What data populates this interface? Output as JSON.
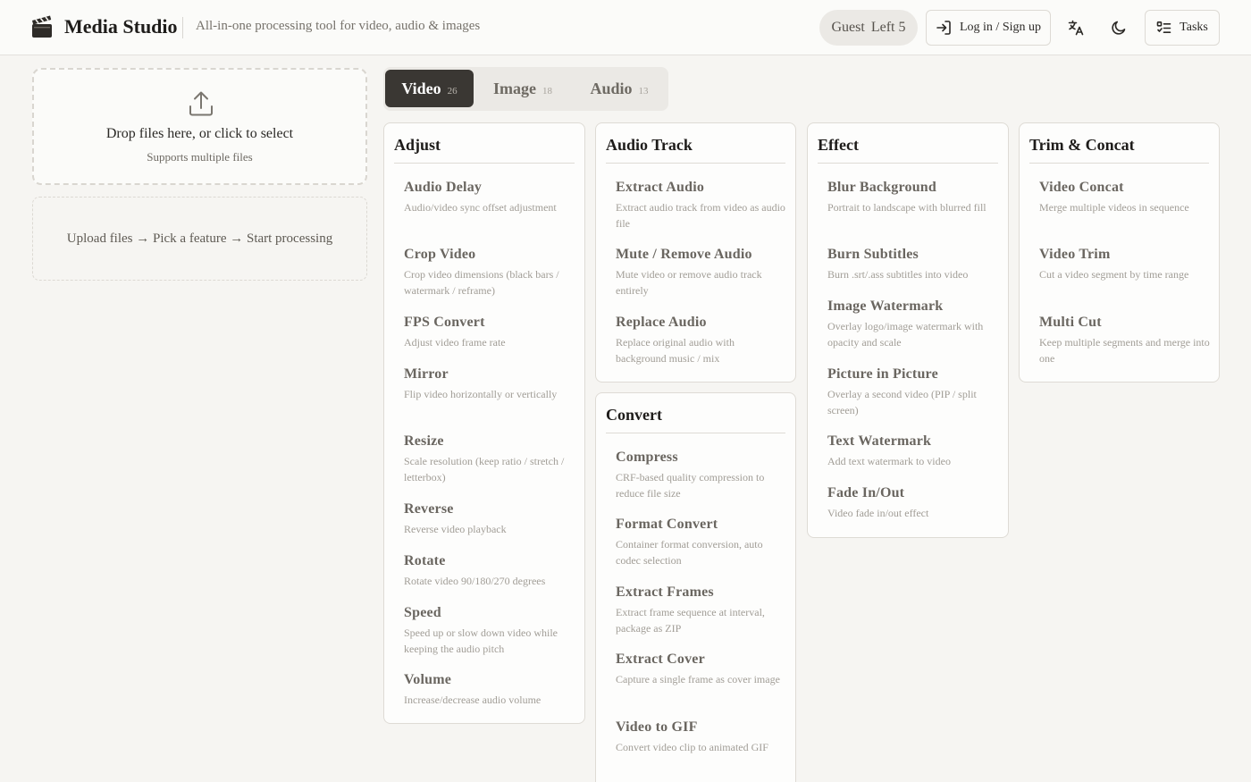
{
  "header": {
    "app_title": "Media Studio",
    "tagline": "All-in-one processing tool for video, audio & images",
    "guest_label": "Guest",
    "guest_left": "Left 5",
    "login_label": "Log in / Sign up",
    "tasks_label": "Tasks",
    "icons": [
      "clapperboard-icon",
      "login-icon",
      "translate-icon",
      "moon-icon",
      "tasks-list-icon"
    ]
  },
  "upload": {
    "title": "Drop files here, or click to select",
    "subtitle": "Supports multiple files",
    "steps": "Upload files → Pick a feature → Start processing"
  },
  "tabs": [
    {
      "label": "Video",
      "count": "26",
      "active": true
    },
    {
      "label": "Image",
      "count": "18",
      "active": false
    },
    {
      "label": "Audio",
      "count": "13",
      "active": false
    }
  ],
  "groups": {
    "adjust": {
      "title": "Adjust",
      "items": [
        {
          "name": "Audio Delay",
          "desc": "Audio/video sync offset adjustment"
        },
        {
          "name": "Crop Video",
          "desc": "Crop video dimensions (black bars / watermark / reframe)"
        },
        {
          "name": "FPS Convert",
          "desc": "Adjust video frame rate"
        },
        {
          "name": "Mirror",
          "desc": "Flip video horizontally or vertically"
        },
        {
          "name": "Resize",
          "desc": "Scale resolution (keep ratio / stretch / letterbox)"
        },
        {
          "name": "Reverse",
          "desc": "Reverse video playback"
        },
        {
          "name": "Rotate",
          "desc": "Rotate video 90/180/270 degrees"
        },
        {
          "name": "Speed",
          "desc": "Speed up or slow down video while keeping the audio pitch"
        },
        {
          "name": "Volume",
          "desc": "Increase/decrease audio volume"
        }
      ]
    },
    "audio_track": {
      "title": "Audio Track",
      "items": [
        {
          "name": "Extract Audio",
          "desc": "Extract audio track from video as audio file"
        },
        {
          "name": "Mute / Remove Audio",
          "desc": "Mute video or remove audio track entirely"
        },
        {
          "name": "Replace Audio",
          "desc": "Replace original audio with background music / mix"
        }
      ]
    },
    "convert": {
      "title": "Convert",
      "items": [
        {
          "name": "Compress",
          "desc": "CRF-based quality compression to reduce file size"
        },
        {
          "name": "Format Convert",
          "desc": "Container format conversion, auto codec selection"
        },
        {
          "name": "Extract Frames",
          "desc": "Extract frame sequence at interval, package as ZIP"
        },
        {
          "name": "Extract Cover",
          "desc": "Capture a single frame as cover image"
        },
        {
          "name": "Video to GIF",
          "desc": "Convert video clip to animated GIF"
        }
      ]
    },
    "effect": {
      "title": "Effect",
      "items": [
        {
          "name": "Blur Background",
          "desc": "Portrait to landscape with blurred fill"
        },
        {
          "name": "Burn Subtitles",
          "desc": "Burn .srt/.ass subtitles into video"
        },
        {
          "name": "Image Watermark",
          "desc": "Overlay logo/image watermark with opacity and scale"
        },
        {
          "name": "Picture in Picture",
          "desc": "Overlay a second video (PIP / split screen)"
        },
        {
          "name": "Text Watermark",
          "desc": "Add text watermark to video"
        },
        {
          "name": "Fade In/Out",
          "desc": "Video fade in/out effect"
        }
      ]
    },
    "trim_concat": {
      "title": "Trim & Concat",
      "items": [
        {
          "name": "Video Concat",
          "desc": "Merge multiple videos in sequence"
        },
        {
          "name": "Video Trim",
          "desc": "Cut a video segment by time range"
        },
        {
          "name": "Multi Cut",
          "desc": "Keep multiple segments and merge into one"
        }
      ]
    }
  }
}
